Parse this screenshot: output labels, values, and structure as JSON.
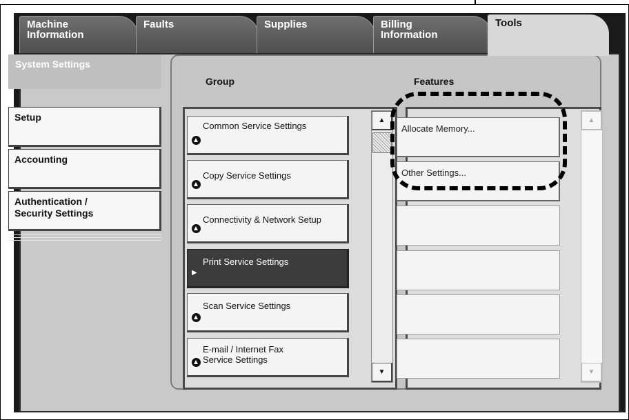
{
  "tabs": [
    {
      "lines": [
        "Machine",
        "Information"
      ],
      "active": false
    },
    {
      "lines": [
        "Faults"
      ],
      "active": false
    },
    {
      "lines": [
        "Supplies"
      ],
      "active": false
    },
    {
      "lines": [
        "Billing",
        "Information"
      ],
      "active": false
    },
    {
      "lines": [
        "Tools"
      ],
      "active": true
    }
  ],
  "sidebar": {
    "header": "System Settings",
    "items": [
      {
        "lines": [
          "Setup"
        ]
      },
      {
        "lines": [
          "Accounting"
        ]
      },
      {
        "lines": [
          "Authentication /",
          "Security Settings"
        ]
      }
    ]
  },
  "group": {
    "title": "Group",
    "items": [
      {
        "lines": [
          "Common Service Settings"
        ],
        "selected": false,
        "icon": "up-triangle-circle-icon"
      },
      {
        "lines": [
          "Copy Service Settings"
        ],
        "selected": false,
        "icon": "up-triangle-circle-icon"
      },
      {
        "lines": [
          "Connectivity & Network Setup"
        ],
        "selected": false,
        "icon": "up-triangle-circle-icon"
      },
      {
        "lines": [
          "Print Service Settings"
        ],
        "selected": true,
        "icon": "right-arrow-icon"
      },
      {
        "lines": [
          "Scan Service Settings"
        ],
        "selected": false,
        "icon": "up-triangle-circle-icon"
      },
      {
        "lines": [
          "E-mail / Internet Fax",
          "Service Settings"
        ],
        "selected": false,
        "icon": "up-triangle-circle-icon"
      }
    ],
    "scroll_up_icon": "▲",
    "scroll_down_icon": "▼"
  },
  "features": {
    "title": "Features",
    "items": [
      {
        "label": "Allocate Memory..."
      },
      {
        "label": "Other Settings..."
      },
      {
        "label": ""
      },
      {
        "label": ""
      },
      {
        "label": ""
      },
      {
        "label": ""
      }
    ],
    "scroll_up_icon": "▲",
    "scroll_down_icon": "▼"
  },
  "colors": {
    "tab_inactive": "#5a5a5a",
    "tab_active": "#d8d8d8",
    "selected_item": "#3c3c3c",
    "panel": "#c6c6c6"
  }
}
